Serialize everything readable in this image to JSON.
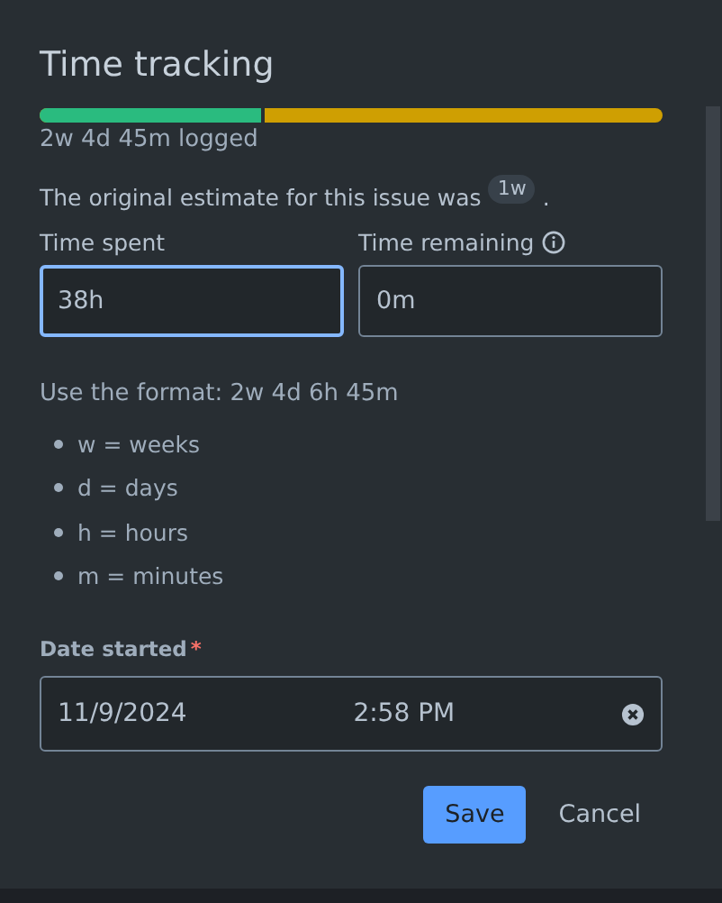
{
  "title": "Time tracking",
  "progress": {
    "level": 0.355,
    "logged": "2w 4d 45m logged"
  },
  "estimate": {
    "text": "The original estimate for this issue was",
    "value": "1w",
    "end": "."
  },
  "fields": [
    {
      "label": "Time spent",
      "value": "38h",
      "focused": true,
      "info": false
    },
    {
      "label": "Time remaining",
      "value": "0m",
      "focused": false,
      "info": true
    }
  ],
  "format_hint": "Use the format: 2w 4d 6h 45m",
  "units": [
    "w = weeks",
    "d = days",
    "h = hours",
    "m = minutes"
  ],
  "date_started": {
    "label": "Date started",
    "required_mark": "*",
    "date": "11/9/2024",
    "time": "2:58 PM"
  },
  "buttons": [
    {
      "label": "Save",
      "kind": "primary"
    },
    {
      "label": "Cancel",
      "kind": "link"
    }
  ]
}
